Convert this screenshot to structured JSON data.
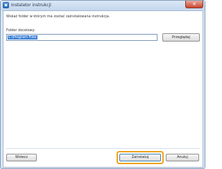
{
  "window": {
    "title": "Instalator instrukcji",
    "close_symbol": "✕"
  },
  "content": {
    "instruction": "Wskaż folder w którym ma zostać zainstalowana instrukcja.",
    "folder_label": "Folder docelowy:",
    "folder_path": "C:\\Program Files",
    "browse_label": "Przeglądaj"
  },
  "footer": {
    "back_label": "Wstecz",
    "install_label": "Zainstaluj",
    "cancel_label": "Anuluj"
  },
  "colors": {
    "focus_highlight": "#f0a018",
    "selection": "#3b80d6",
    "close_button": "#c9452f"
  },
  "icons": {
    "app": "installer-app-icon",
    "close": "close-icon"
  }
}
